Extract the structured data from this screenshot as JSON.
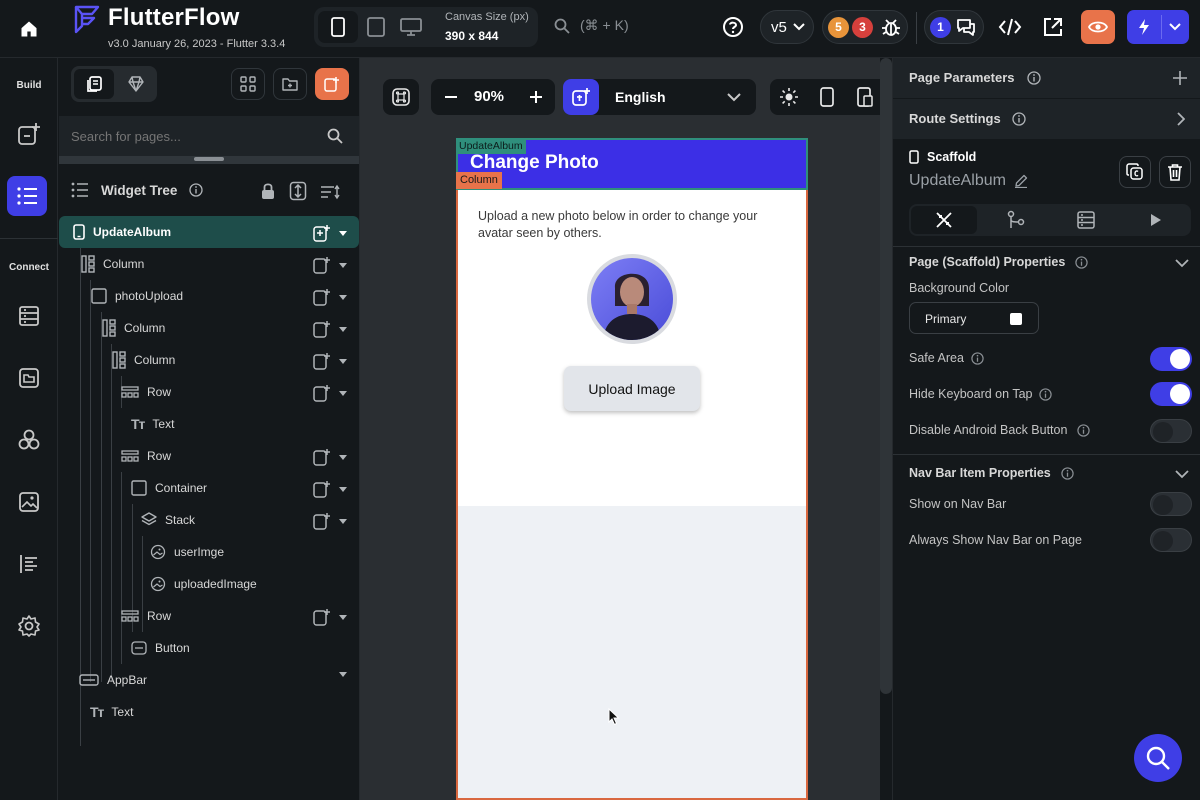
{
  "app": {
    "name": "FlutterFlow",
    "version": "v3.0 January 26, 2023 - Flutter 3.3.4"
  },
  "topbar": {
    "canvas_size_label": "Canvas Size (px)",
    "canvas_size_value": "390 x 844",
    "search_shortcut": "(⌘ + K)",
    "version_select": "v5",
    "warnings_count": "5",
    "errors_count": "3",
    "comments_count": "1"
  },
  "rail": {
    "build_label": "Build",
    "connect_label": "Connect"
  },
  "tree": {
    "search_placeholder": "Search for pages...",
    "title": "Widget Tree",
    "items": [
      {
        "label": "UpdateAlbum"
      },
      {
        "label": "Column"
      },
      {
        "label": "photoUpload"
      },
      {
        "label": "Column"
      },
      {
        "label": "Column"
      },
      {
        "label": "Row"
      },
      {
        "label": "Text"
      },
      {
        "label": "Row"
      },
      {
        "label": "Container"
      },
      {
        "label": "Stack"
      },
      {
        "label": "userImge"
      },
      {
        "label": "uploadedImage"
      },
      {
        "label": "Row"
      },
      {
        "label": "Button"
      },
      {
        "label": "AppBar"
      },
      {
        "label": "Text"
      }
    ]
  },
  "canvas": {
    "zoom": "90%",
    "language": "English",
    "appbar_tag": "UpdateAlbum",
    "column_tag": "Column",
    "appbar_title": "Change Photo",
    "description": "Upload a new photo below in order to change your avatar seen by others.",
    "upload_button": "Upload Image"
  },
  "props": {
    "page_parameters": "Page Parameters",
    "route_settings": "Route Settings",
    "widget_type": "Scaffold",
    "widget_name": "UpdateAlbum",
    "section_title": "Page (Scaffold) Properties",
    "bg_color_label": "Background Color",
    "bg_color_value": "Primary",
    "safe_area": "Safe Area",
    "safe_area_on": true,
    "hide_keyboard": "Hide Keyboard on Tap",
    "hide_keyboard_on": true,
    "disable_back": "Disable Android Back Button",
    "disable_back_on": false,
    "navbar_section": "Nav Bar Item Properties",
    "show_navbar": "Show on Nav Bar",
    "show_navbar_on": false,
    "always_show_navbar": "Always Show Nav Bar on Page",
    "always_show_navbar_on": false
  },
  "colors": {
    "accent": "#3f3ee6",
    "orange": "#e8734a",
    "tree_selected": "#1e4d4a",
    "canvas_bg": "#2a2e32"
  }
}
